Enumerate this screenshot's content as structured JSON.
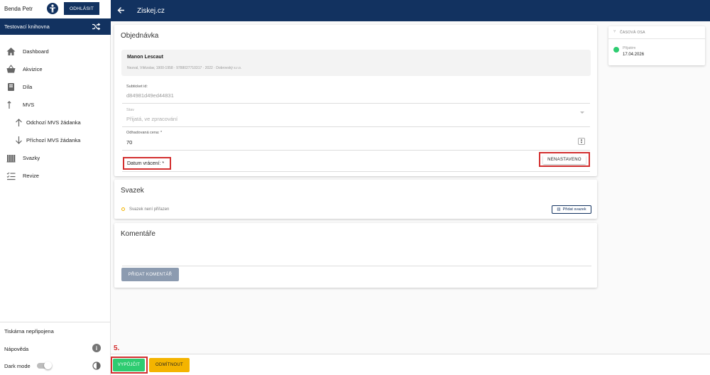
{
  "sidebar": {
    "user_name": "Benda Petr",
    "logout_label": "ODHLÁSIT",
    "library_name": "Testovací knihovna",
    "items": [
      {
        "label": "Dashboard",
        "icon": "home-icon"
      },
      {
        "label": "Akvizice",
        "icon": "basket-icon"
      },
      {
        "label": "Díla",
        "icon": "book-icon"
      },
      {
        "label": "MVS",
        "icon": "swap-vertical-icon"
      },
      {
        "label": "Odchozí MVS žádanka",
        "icon": "arrow-up-icon"
      },
      {
        "label": "Příchozí MVS žádanka",
        "icon": "arrow-down-icon"
      },
      {
        "label": "Svazky",
        "icon": "library-icon"
      },
      {
        "label": "Revize",
        "icon": "checklist-icon"
      }
    ],
    "printer_status": "Tiskárna nepřipojena",
    "help_label": "Nápověda",
    "dark_mode_label": "Dark mode"
  },
  "header": {
    "title": "Ziskej.cz"
  },
  "order": {
    "title": "Objednávka",
    "book_title": "Manon Lescaut",
    "book_meta": "Nezval, Vítězslav, 1900-1958 · 9788027710317 · 2022 · Dobrovský s.r.o.",
    "subticket_label": "Subticket id:",
    "subticket_value": "d84981d49ed44831",
    "status_label": "Stav",
    "status_value": "Přijatá, ve zpracování",
    "price_label": "Odhadovaná cena: *",
    "price_value": "70",
    "return_date_label": "Datum vrácení: *",
    "not_set_label": "NENASTAVENO"
  },
  "bundle": {
    "title": "Svazek",
    "status": "Svazek není přiřazen",
    "add_label": "Přidat svazek"
  },
  "comments": {
    "title": "Komentáře",
    "add_label": "PŘIDAT KOMENTÁŘ"
  },
  "timeline": {
    "title": "ČASOVÁ OSA",
    "entry_status": "Přijatém",
    "entry_date": "17.04.2026",
    "dot_color": "#2ecc71"
  },
  "footer": {
    "step_label": "5.",
    "lend_label": "VYPŮJČIT",
    "reject_label": "ODMÍTNOUT"
  },
  "colors": {
    "brand": "#123260",
    "highlight": "#d32f2f",
    "success": "#2ecc71",
    "warning": "#f4b400"
  }
}
